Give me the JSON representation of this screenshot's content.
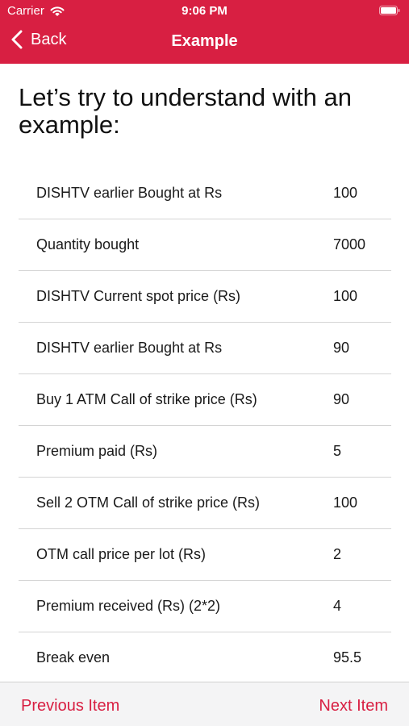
{
  "status_bar": {
    "carrier": "Carrier",
    "time": "9:06 PM"
  },
  "nav": {
    "back_label": "Back",
    "title": "Example"
  },
  "heading": "Let’s try to understand with an example:",
  "rows": [
    {
      "label": "DISHTV earlier Bought at Rs",
      "value": "100"
    },
    {
      "label": "Quantity bought",
      "value": "7000"
    },
    {
      "label": "DISHTV Current spot price (Rs)",
      "value": "100"
    },
    {
      "label": "DISHTV earlier Bought at Rs",
      "value": "90"
    },
    {
      "label": "Buy 1 ATM Call of strike price (Rs)",
      "value": "90"
    },
    {
      "label": "Premium paid (Rs)",
      "value": "5"
    },
    {
      "label": "Sell 2 OTM Call of strike price (Rs)",
      "value": "100"
    },
    {
      "label": "OTM call price per lot (Rs)",
      "value": "2"
    },
    {
      "label": "Premium received (Rs) (2*2)",
      "value": "4"
    },
    {
      "label": "Break even",
      "value": "95.5"
    }
  ],
  "footer": {
    "previous_label": "Previous Item",
    "next_label": "Next Item"
  },
  "colors": {
    "accent": "#d81f42",
    "footer_background": "#f4f4f5"
  },
  "icons": [
    "wifi-icon",
    "battery-icon",
    "chevron-left-icon"
  ]
}
